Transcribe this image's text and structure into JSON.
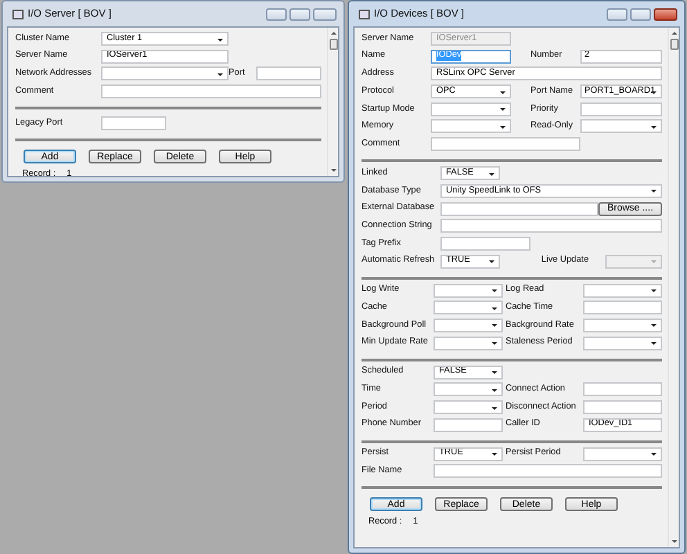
{
  "windows": [
    {
      "title": "I/O Server [ BOV ]",
      "active": false,
      "sections": [
        {
          "rows": [
            [
              {
                "label": "Cluster Name",
                "kind": "dropdown",
                "value": "Cluster 1"
              }
            ],
            [
              {
                "label": "Server Name",
                "kind": "textbox",
                "value": "IOServer1"
              }
            ],
            [
              {
                "label": "Network Addresses",
                "kind": "dropdown"
              },
              {
                "label": "Port",
                "kind": "textbox"
              }
            ],
            [
              {
                "label": "Comment",
                "kind": "textbox"
              }
            ]
          ]
        },
        {
          "rows": [
            [
              {
                "label": "Legacy Port",
                "kind": "textbox"
              }
            ]
          ]
        }
      ],
      "buttons": [
        {
          "label": "Add",
          "default": true
        },
        {
          "label": "Replace",
          "default": false
        },
        {
          "label": "Delete",
          "default": false
        },
        {
          "label": "Help",
          "default": false
        }
      ],
      "record": {
        "label": "Record :",
        "value": "1"
      }
    },
    {
      "title": "I/O Devices [ BOV ]",
      "active": true,
      "sections": [
        {
          "rows": [
            [
              {
                "label": "Server Name",
                "kind": "textbox",
                "value": "IOServer1",
                "disabled": true
              }
            ],
            [
              {
                "label": "Name",
                "kind": "textbox",
                "value": "IODev",
                "selected": true
              },
              {
                "label": "Number",
                "kind": "textbox",
                "value": "2"
              }
            ],
            [
              {
                "label": "Address",
                "kind": "textbox",
                "value": "RSLinx OPC Server"
              }
            ],
            [
              {
                "label": "Protocol",
                "kind": "dropdown",
                "value": "OPC"
              },
              {
                "label": "Port Name",
                "kind": "dropdown",
                "value": "PORT1_BOARD1"
              }
            ],
            [
              {
                "label": "Startup Mode",
                "kind": "dropdown"
              },
              {
                "label": "Priority",
                "kind": "textbox"
              }
            ],
            [
              {
                "label": "Memory",
                "kind": "dropdown"
              },
              {
                "label": "Read-Only",
                "kind": "dropdown"
              }
            ],
            [
              {
                "label": "Comment",
                "kind": "textbox"
              }
            ]
          ]
        },
        {
          "rows": [
            [
              {
                "label": "Linked",
                "kind": "dropdown",
                "value": "FALSE"
              }
            ],
            [
              {
                "label": "Database Type",
                "kind": "dropdown",
                "value": "Unity SpeedLink to OFS"
              }
            ],
            [
              {
                "label": "External Database",
                "kind": "textbox"
              },
              {
                "kind": "button",
                "value": "Browse ...."
              }
            ],
            [
              {
                "label": "Connection String",
                "kind": "textbox"
              }
            ],
            [
              {
                "label": "Tag Prefix",
                "kind": "textbox"
              }
            ],
            [
              {
                "label": "Automatic Refresh",
                "kind": "dropdown",
                "value": "TRUE"
              },
              {
                "label": "Live Update",
                "kind": "dropdown",
                "disabled": true
              }
            ]
          ]
        },
        {
          "rows": [
            [
              {
                "label": "Log Write",
                "kind": "dropdown"
              },
              {
                "label": "Log Read",
                "kind": "dropdown"
              }
            ],
            [
              {
                "label": "Cache",
                "kind": "dropdown"
              },
              {
                "label": "Cache Time",
                "kind": "textbox"
              }
            ],
            [
              {
                "label": "Background Poll",
                "kind": "dropdown"
              },
              {
                "label": "Background Rate",
                "kind": "dropdown"
              }
            ],
            [
              {
                "label": "Min Update Rate",
                "kind": "dropdown"
              },
              {
                "label": "Staleness Period",
                "kind": "dropdown"
              }
            ]
          ]
        },
        {
          "rows": [
            [
              {
                "label": "Scheduled",
                "kind": "dropdown",
                "value": "FALSE"
              }
            ],
            [
              {
                "label": "Time",
                "kind": "dropdown"
              },
              {
                "label": "Connect Action",
                "kind": "textbox"
              }
            ],
            [
              {
                "label": "Period",
                "kind": "dropdown"
              },
              {
                "label": "Disconnect Action",
                "kind": "textbox"
              }
            ],
            [
              {
                "label": "Phone Number",
                "kind": "textbox"
              },
              {
                "label": "Caller ID",
                "kind": "textbox",
                "value": "IODev_ID1"
              }
            ]
          ]
        },
        {
          "rows": [
            [
              {
                "label": "Persist",
                "kind": "dropdown",
                "value": "TRUE"
              },
              {
                "label": "Persist Period",
                "kind": "dropdown"
              }
            ],
            [
              {
                "label": "File Name",
                "kind": "textbox"
              }
            ]
          ]
        }
      ],
      "buttons": [
        {
          "label": "Add",
          "default": true
        },
        {
          "label": "Replace",
          "default": false
        },
        {
          "label": "Delete",
          "default": false
        },
        {
          "label": "Help",
          "default": false
        }
      ],
      "record": {
        "label": "Record :",
        "value": "1"
      }
    }
  ]
}
